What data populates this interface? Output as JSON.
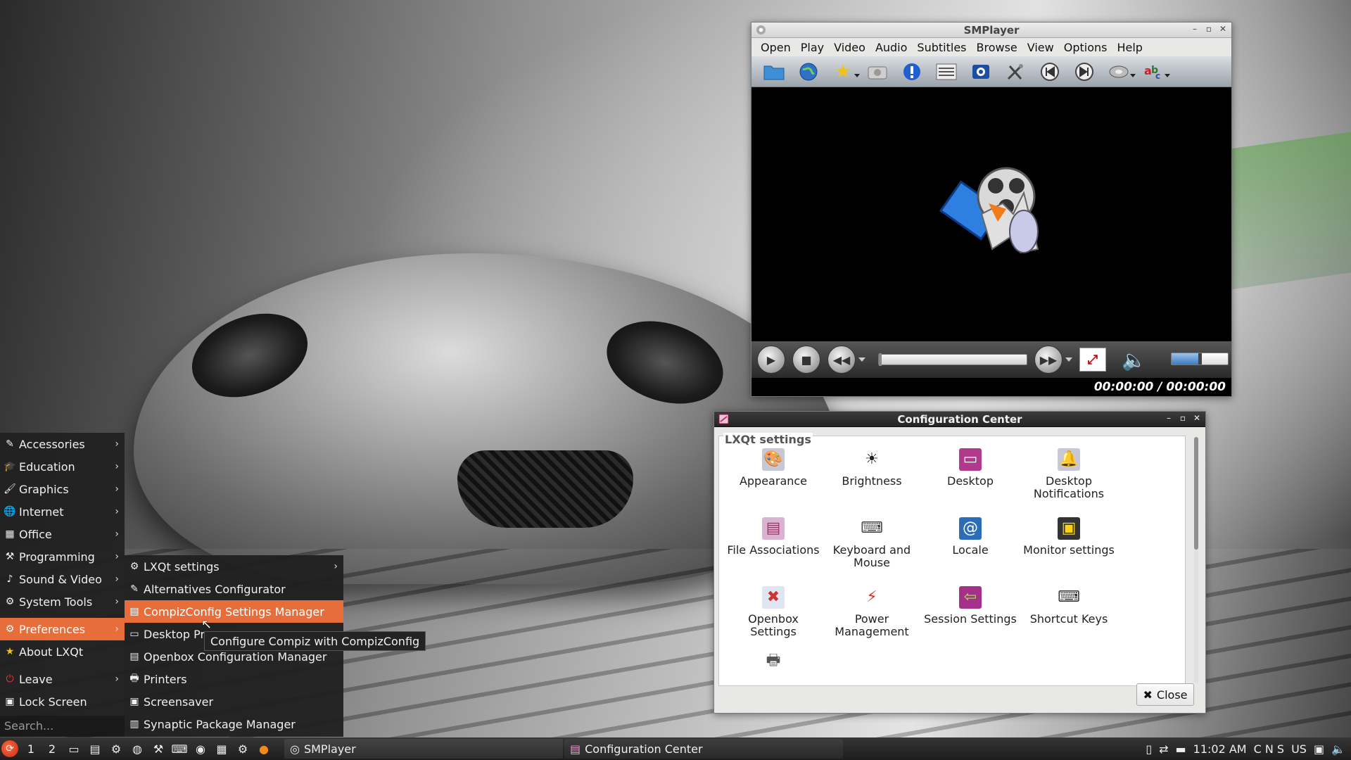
{
  "smplayer": {
    "title": "SMPlayer",
    "window_buttons": [
      "–",
      "▫",
      "✕"
    ],
    "menu": [
      "Open",
      "Play",
      "Video",
      "Audio",
      "Subtitles",
      "Browse",
      "View",
      "Options",
      "Help"
    ],
    "toolbar_icons": [
      "folder-icon",
      "globe-icon",
      "star-icon",
      "screenshot-icon",
      "info-icon",
      "playlist-icon",
      "video-equalizer-icon",
      "preferences-icon",
      "previous-icon",
      "next-icon",
      "audio-track-icon",
      "subtitles-icon"
    ],
    "time_display": "00:00:00 / 00:00:00",
    "volume_level": 0.5
  },
  "config_center": {
    "title": "Configuration Center",
    "window_buttons": [
      "–",
      "▫",
      "✕"
    ],
    "section_title": "LXQt settings",
    "items": [
      {
        "label": "Appearance",
        "icon": "appearance-icon"
      },
      {
        "label": "Brightness",
        "icon": "brightness-icon"
      },
      {
        "label": "Desktop",
        "icon": "desktop-icon"
      },
      {
        "label": "Desktop\nNotifications",
        "icon": "notifications-icon"
      },
      {
        "label": "File Associations",
        "icon": "file-associations-icon"
      },
      {
        "label": "Keyboard and\nMouse",
        "icon": "keyboard-icon"
      },
      {
        "label": "Locale",
        "icon": "locale-icon"
      },
      {
        "label": "Monitor settings",
        "icon": "monitor-icon"
      },
      {
        "label": "Openbox\nSettings",
        "icon": "openbox-icon"
      },
      {
        "label": "Power\nManagement",
        "icon": "power-icon"
      },
      {
        "label": "Session Settings",
        "icon": "session-icon"
      },
      {
        "label": "Shortcut Keys",
        "icon": "shortcut-keys-icon"
      }
    ],
    "close_label": "Close"
  },
  "main_menu": {
    "items": [
      {
        "label": "Accessories",
        "arrow": true
      },
      {
        "label": "Education",
        "arrow": true
      },
      {
        "label": "Graphics",
        "arrow": true
      },
      {
        "label": "Internet",
        "arrow": true
      },
      {
        "label": "Office",
        "arrow": true
      },
      {
        "label": "Programming",
        "arrow": true
      },
      {
        "label": "Sound & Video",
        "arrow": true
      },
      {
        "label": "System Tools",
        "arrow": true
      }
    ],
    "preferences": "Preferences",
    "about": "About LXQt",
    "leave": "Leave",
    "lock_screen": "Lock Screen",
    "search_placeholder": "Search...",
    "active_color": "#e76e3a"
  },
  "sub_menu": {
    "items": [
      {
        "label": "LXQt settings",
        "arrow": true
      },
      {
        "label": "Alternatives Configurator",
        "arrow": false
      },
      {
        "label": "CompizConfig Settings Manager",
        "arrow": false
      },
      {
        "label": "Desktop Pre",
        "arrow": false
      },
      {
        "label": "Openbox Configuration Manager",
        "arrow": false
      },
      {
        "label": "Printers",
        "arrow": false
      },
      {
        "label": "Screensaver",
        "arrow": false
      },
      {
        "label": "Synaptic Package Manager",
        "arrow": false
      }
    ],
    "tooltip": "Configure Compiz with CompizConfig"
  },
  "taskbar": {
    "desktops": [
      "1",
      "2"
    ],
    "tasks": [
      "SMPlayer",
      "Configuration Center"
    ],
    "clock": "11:02 AM",
    "kbd_indicators": "C N S",
    "layout": "US"
  }
}
